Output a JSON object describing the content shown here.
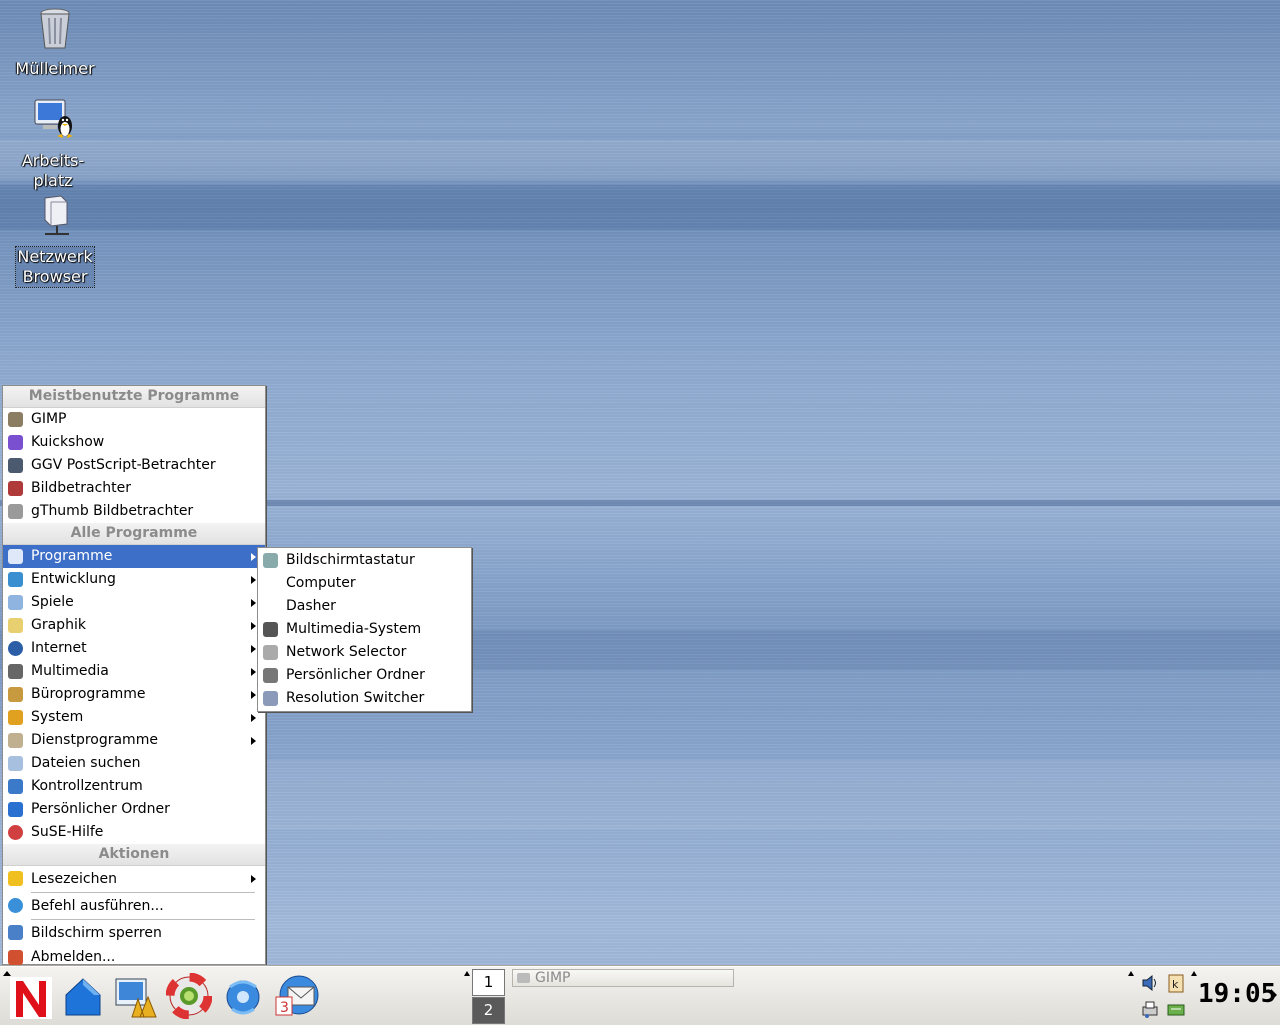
{
  "desktop": {
    "icons": [
      {
        "label": "Mülleimer",
        "icon": "trash-icon"
      },
      {
        "label": "Arbeits-\nplatz",
        "icon": "computer-icon"
      },
      {
        "label": "Netzwerk Browser",
        "icon": "network-icon"
      }
    ]
  },
  "start_menu": {
    "section_frequent": "Meistbenutzte Programme",
    "frequent": [
      "GIMP",
      "Kuickshow",
      "GGV PostScript-Betrachter",
      "Bildbetrachter",
      "gThumb Bildbetrachter"
    ],
    "section_all": "Alle Programme",
    "all": [
      {
        "label": "Programme",
        "submenu": true
      },
      {
        "label": "Entwicklung",
        "submenu": true
      },
      {
        "label": "Spiele",
        "submenu": true
      },
      {
        "label": "Graphik",
        "submenu": true
      },
      {
        "label": "Internet",
        "submenu": true
      },
      {
        "label": "Multimedia",
        "submenu": true
      },
      {
        "label": "Büroprogramme",
        "submenu": true
      },
      {
        "label": "System",
        "submenu": true
      },
      {
        "label": "Dienstprogramme",
        "submenu": true
      },
      {
        "label": "Dateien suchen",
        "submenu": false
      },
      {
        "label": "Kontrollzentrum",
        "submenu": false
      },
      {
        "label": "Persönlicher Ordner",
        "submenu": false
      },
      {
        "label": "SuSE-Hilfe",
        "submenu": false
      }
    ],
    "section_actions": "Aktionen",
    "actions": [
      "Lesezeichen",
      "Befehl ausführen...",
      "Bildschirm sperren",
      "Abmelden..."
    ]
  },
  "submenu_programme": {
    "items": [
      "Bildschirmtastatur",
      "Computer",
      "Dasher",
      "Multimedia-System",
      "Network Selector",
      "Persönlicher Ordner",
      "Resolution Switcher"
    ]
  },
  "taskbar": {
    "pager": [
      "1",
      "2"
    ],
    "task": "GIMP",
    "clock": "19:05",
    "launchers": [
      "kde-start-icon",
      "home-icon",
      "control-center-icon",
      "help-lifebuoy-icon",
      "konqueror-icon",
      "kontact-mail-icon"
    ]
  },
  "colors": {
    "highlight": "#3e6fc8",
    "menu_header": "#8b8b8b"
  }
}
